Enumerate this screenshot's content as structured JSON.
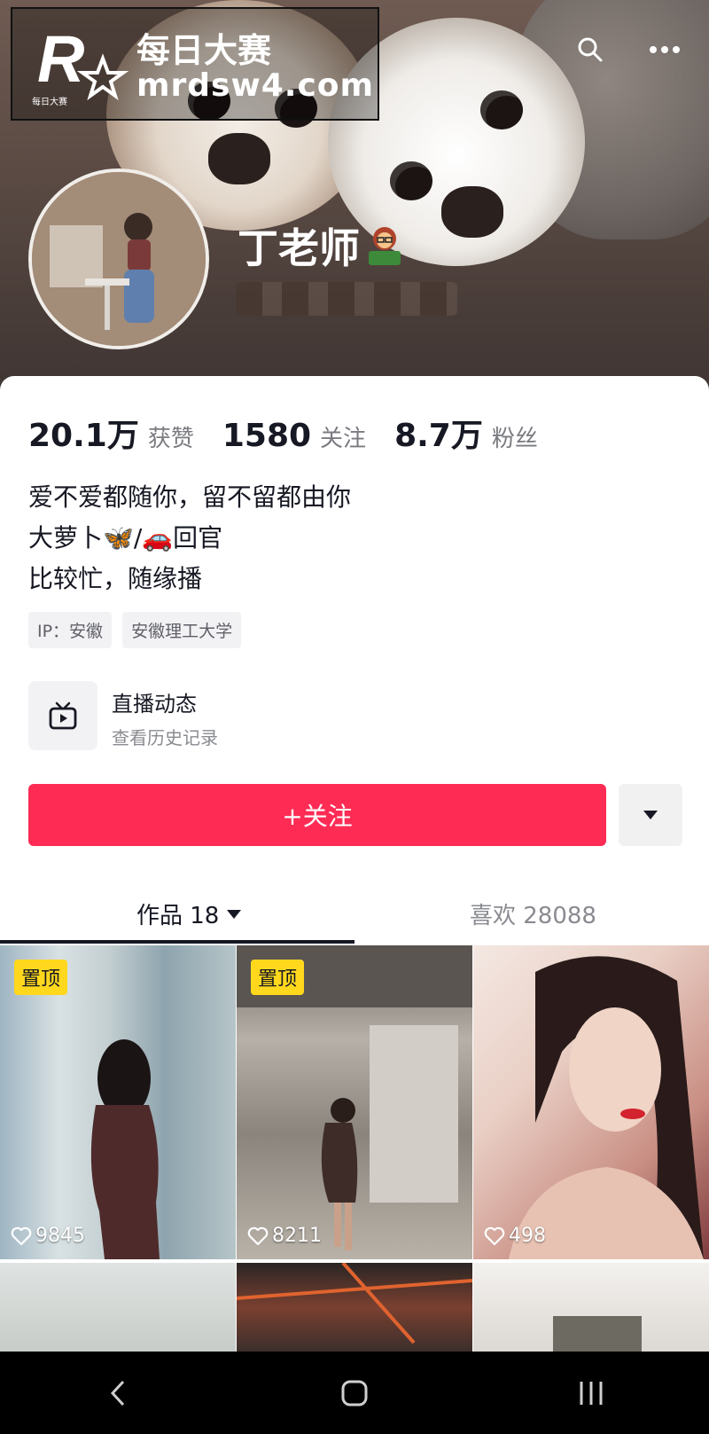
{
  "colors": {
    "accent": "#fe2c55",
    "pin": "#ffd81e",
    "text": "#161823",
    "muted": "#8a8b91"
  },
  "watermark": {
    "title": "每日大赛",
    "url": "mrdsw4.com",
    "logo_letter": "R",
    "logo_small": "每日大赛"
  },
  "profile": {
    "name": "丁老师"
  },
  "stats": [
    {
      "value": "20.1万",
      "label": "获赞"
    },
    {
      "value": "1580",
      "label": "关注"
    },
    {
      "value": "8.7万",
      "label": "粉丝"
    }
  ],
  "bio": [
    "爱不爱都随你，留不留都由你",
    "大萝卜🦋/🚗回官",
    "比较忙，随缘播"
  ],
  "tags": [
    "IP：安徽",
    "安徽理工大学"
  ],
  "live": {
    "title": "直播动态",
    "subtitle": "查看历史记录"
  },
  "follow_button": "+关注",
  "tabs": {
    "works": "作品 18",
    "likes": "喜欢 28088"
  },
  "videos": [
    {
      "pinned": true,
      "pin_label": "置顶",
      "likes": "9845"
    },
    {
      "pinned": true,
      "pin_label": "置顶",
      "likes": "8211"
    },
    {
      "pinned": false,
      "pin_label": "",
      "likes": "498"
    }
  ],
  "icons": [
    "search-icon",
    "more-icon",
    "live-tv-icon",
    "caret-down-icon",
    "heart-icon",
    "back-icon",
    "home-icon",
    "recents-icon"
  ]
}
